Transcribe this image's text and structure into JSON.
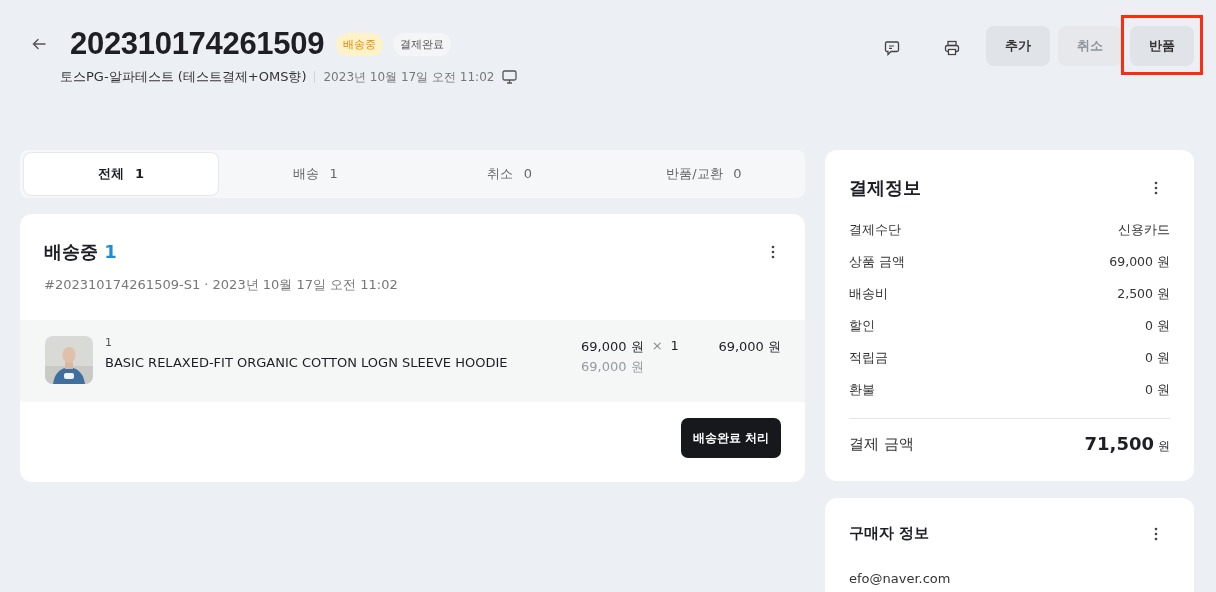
{
  "header": {
    "order_number": "202310174261509",
    "badges": [
      {
        "label": "배송중",
        "kind": "status"
      },
      {
        "label": "결제완료",
        "kind": "neutral"
      }
    ],
    "store": "토스PG-알파테스트 (테스트결제+OMS향)",
    "date": "2023년 10월 17일 오전 11:02",
    "buttons": [
      {
        "label": "추가",
        "disabled": false,
        "highlighted": false
      },
      {
        "label": "취소",
        "disabled": true,
        "highlighted": false
      },
      {
        "label": "반품",
        "disabled": false,
        "highlighted": true
      }
    ]
  },
  "tabs": [
    {
      "label": "전체",
      "count": "1",
      "selected": true
    },
    {
      "label": "배송",
      "count": "1",
      "selected": false
    },
    {
      "label": "취소",
      "count": "0",
      "selected": false
    },
    {
      "label": "반품/교환",
      "count": "0",
      "selected": false
    }
  ],
  "shipment": {
    "title": "배송중",
    "count": "1",
    "meta": "#202310174261509-S1 · 2023년 10월 17일 오전 11:02",
    "items": [
      {
        "number": "1",
        "name": "BASIC RELAXED-FIT ORGANIC COTTON LOGN SLEEVE HOODIE",
        "price": "69,000 원",
        "times": "×",
        "quantity": "1",
        "original_price": "69,000 원",
        "total": "69,000 원"
      }
    ],
    "action": "배송완료 처리"
  },
  "payment": {
    "title": "결제정보",
    "rows": [
      {
        "label": "결제수단",
        "value": "신용카드"
      },
      {
        "label": "상품 금액",
        "value": "69,000 원"
      },
      {
        "label": "배송비",
        "value": "2,500 원"
      },
      {
        "label": "할인",
        "value": "0 원"
      },
      {
        "label": "적립금",
        "value": "0 원"
      },
      {
        "label": "환불",
        "value": "0 원"
      }
    ],
    "total_label": "결제 금액",
    "total_value": "71,500",
    "total_unit": "원"
  },
  "buyer": {
    "title": "구매자 정보",
    "email": "efo@naver.com"
  }
}
